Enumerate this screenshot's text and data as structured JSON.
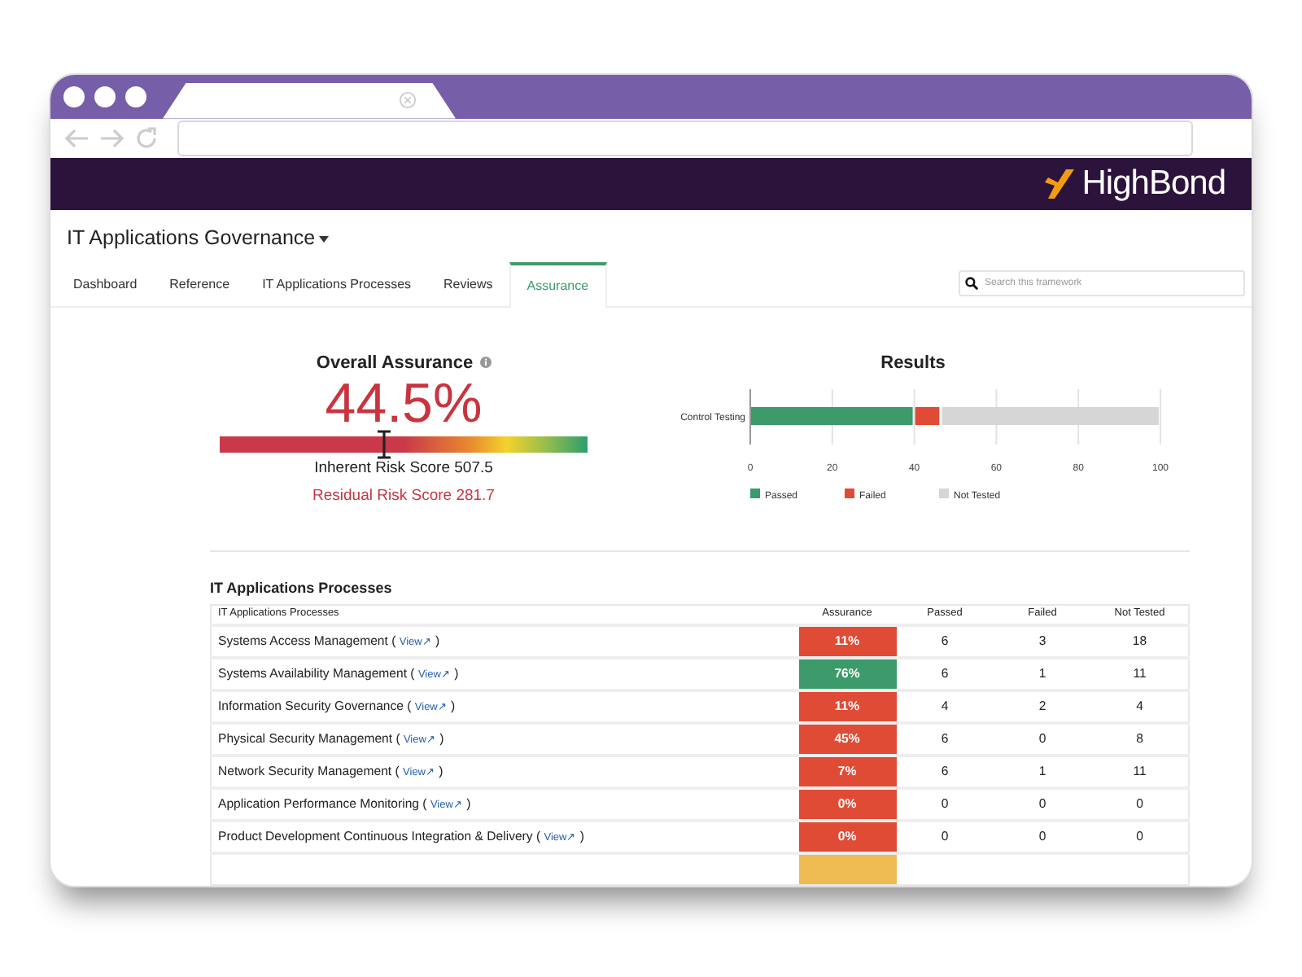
{
  "brand": {
    "name": "HighBond"
  },
  "framework": {
    "title": "IT Applications Governance"
  },
  "tabs": [
    {
      "label": "Dashboard",
      "selected": false
    },
    {
      "label": "Reference",
      "selected": false
    },
    {
      "label": "IT Applications Processes",
      "selected": false
    },
    {
      "label": "Reviews",
      "selected": false
    },
    {
      "label": "Assurance",
      "selected": true
    }
  ],
  "search": {
    "placeholder": "Search this framework"
  },
  "assurance": {
    "title": "Overall Assurance",
    "value": "44.5%",
    "level": 0.445,
    "inherent": "Inherent Risk Score 507.5",
    "residual": "Residual Risk Score 281.7"
  },
  "results": {
    "title": "Results",
    "chart_data": {
      "type": "bar",
      "orientation": "horizontal",
      "stacked": true,
      "grid": true,
      "legend": true,
      "categories": [
        "Control Testing"
      ],
      "xlim": [
        0,
        100
      ],
      "xticks": [
        0,
        20,
        40,
        60,
        80,
        100
      ],
      "series": [
        {
          "name": "Passed",
          "color": "#3d9a6a",
          "values": [
            40
          ]
        },
        {
          "name": "Failed",
          "color": "#e04b36",
          "values": [
            6.5
          ]
        },
        {
          "name": "Not Tested",
          "color": "#d6d6d6",
          "values": [
            53.5
          ]
        }
      ]
    }
  },
  "table": {
    "title": "IT Applications Processes",
    "columns": [
      "IT Applications Processes",
      "Assurance",
      "Passed",
      "Failed",
      "Not Tested"
    ],
    "rows": [
      {
        "name": "Systems Access Management (",
        "link": "View↗",
        "suffix": ")",
        "color": "#e04b36",
        "assurance": "11%",
        "passed": "6",
        "failed": "3",
        "not_tested": "18"
      },
      {
        "name": "Systems Availability Management (",
        "link": "View↗",
        "suffix": ")",
        "color": "#3d9a6a",
        "assurance": "76%",
        "passed": "6",
        "failed": "1",
        "not_tested": "11"
      },
      {
        "name": "Information Security Governance (",
        "link": "View↗",
        "suffix": ")",
        "color": "#e04b36",
        "assurance": "11%",
        "passed": "4",
        "failed": "2",
        "not_tested": "4"
      },
      {
        "name": "Physical Security Management (",
        "link": "View↗",
        "suffix": ")",
        "color": "#e04b36",
        "assurance": "45%",
        "passed": "6",
        "failed": "0",
        "not_tested": "8"
      },
      {
        "name": "Network Security Management (",
        "link": "View↗",
        "suffix": ")",
        "color": "#e04b36",
        "assurance": "7%",
        "passed": "6",
        "failed": "1",
        "not_tested": "11"
      },
      {
        "name": "Application Performance Monitoring (",
        "link": "View↗",
        "suffix": ")",
        "color": "#e04b36",
        "assurance": "0%",
        "passed": "0",
        "failed": "0",
        "not_tested": "0"
      },
      {
        "name": "Product Development Continuous Integration & Delivery (",
        "link": "View↗",
        "suffix": ")",
        "color": "#e04b36",
        "assurance": "0%",
        "passed": "0",
        "failed": "0",
        "not_tested": "0"
      },
      {
        "color": "#eebc52"
      }
    ]
  }
}
